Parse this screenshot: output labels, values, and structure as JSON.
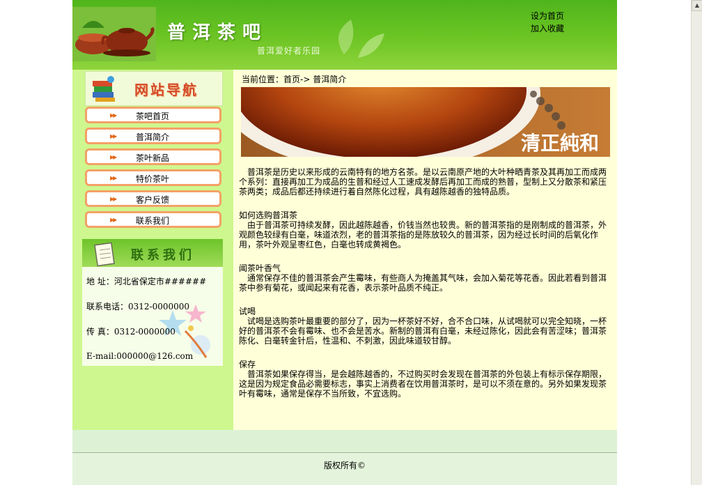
{
  "header": {
    "title": "普洱茶吧",
    "subtitle": "普洱爱好者乐园",
    "links": [
      "设为首页",
      "加入收藏"
    ]
  },
  "sidebar": {
    "nav_banner": "网站导航",
    "nav_items": [
      "茶吧首页",
      "普洱简介",
      "茶叶新品",
      "特价茶叶",
      "客户反馈",
      "联系我们"
    ],
    "contact_banner": "联系我们",
    "contact": {
      "address": "地  址：河北省保定市######",
      "phone": "联系电话：0312-0000000",
      "fax": "传  真：0312-0000000",
      "email": "E-mail:000000@126.com"
    }
  },
  "main": {
    "breadcrumb": "当前位置：首页-> 普洱简介",
    "hero_text": "清正純和",
    "intro": "普洱茶是历史以来形成的云南特有的地方名茶。是以云南原产地的大叶种晒青茶及其再加工而成两个系列：直接再加工为成品的生普和经过人工速成发酵后再加工而成的熟普，型制上又分散茶和紧压茶两类；成品后都还持续进行着自然陈化过程，具有越陈越香的独特品质。",
    "sections": [
      {
        "title": "如何选购普洱茶",
        "text": "由于普洱茶可持续发酵，因此越陈越香，价钱当然也较贵。新的普洱茶指的是刚制成的普洱茶，外观颜色较绿有白毫，味道浓烈，老的普洱茶指的是陈放较久的普洱茶，因为经过长时间的后氧化作用，茶叶外观呈枣红色，白毫也转成黄褐色。"
      },
      {
        "title": "闻茶叶香气",
        "text": "通常保存不佳的普洱茶会产生霉味，有些商人为掩盖其气味，会加入菊花等花香。因此若看到普洱茶中参有菊花，或闻起来有花香，表示茶叶品质不纯正。"
      },
      {
        "title": "试喝",
        "text": "试喝是选购茶叶最重要的部分了，因为一杯茶好不好，合不合口味，从试喝就可以完全知晓，一杯好的普洱茶不会有霉味、也不会是苦水。新制的普洱有白毫，未经过陈化，因此会有苦涩味；普洱茶陈化、白毫转金针后，性温和、不刺激，因此味道较甘醇。"
      },
      {
        "title": "保存",
        "text": "普洱茶如果保存得当，是会越陈越香的，不过购买时会发现在普洱茶的外包装上有标示保存期限，这是因为规定食品必需要标志，事实上消费者在饮用普洱茶时，是可以不须在意的。另外如果发现茶叶有霉味，通常是保存不当所致，不宜选购。"
      }
    ]
  },
  "footer": {
    "copyright": "版权所有©"
  },
  "colors": {
    "header_green": "#5fbf20",
    "sidebar_green": "#cef78f",
    "content_bg": "#ffffd8",
    "nav_border": "#f4a167"
  }
}
